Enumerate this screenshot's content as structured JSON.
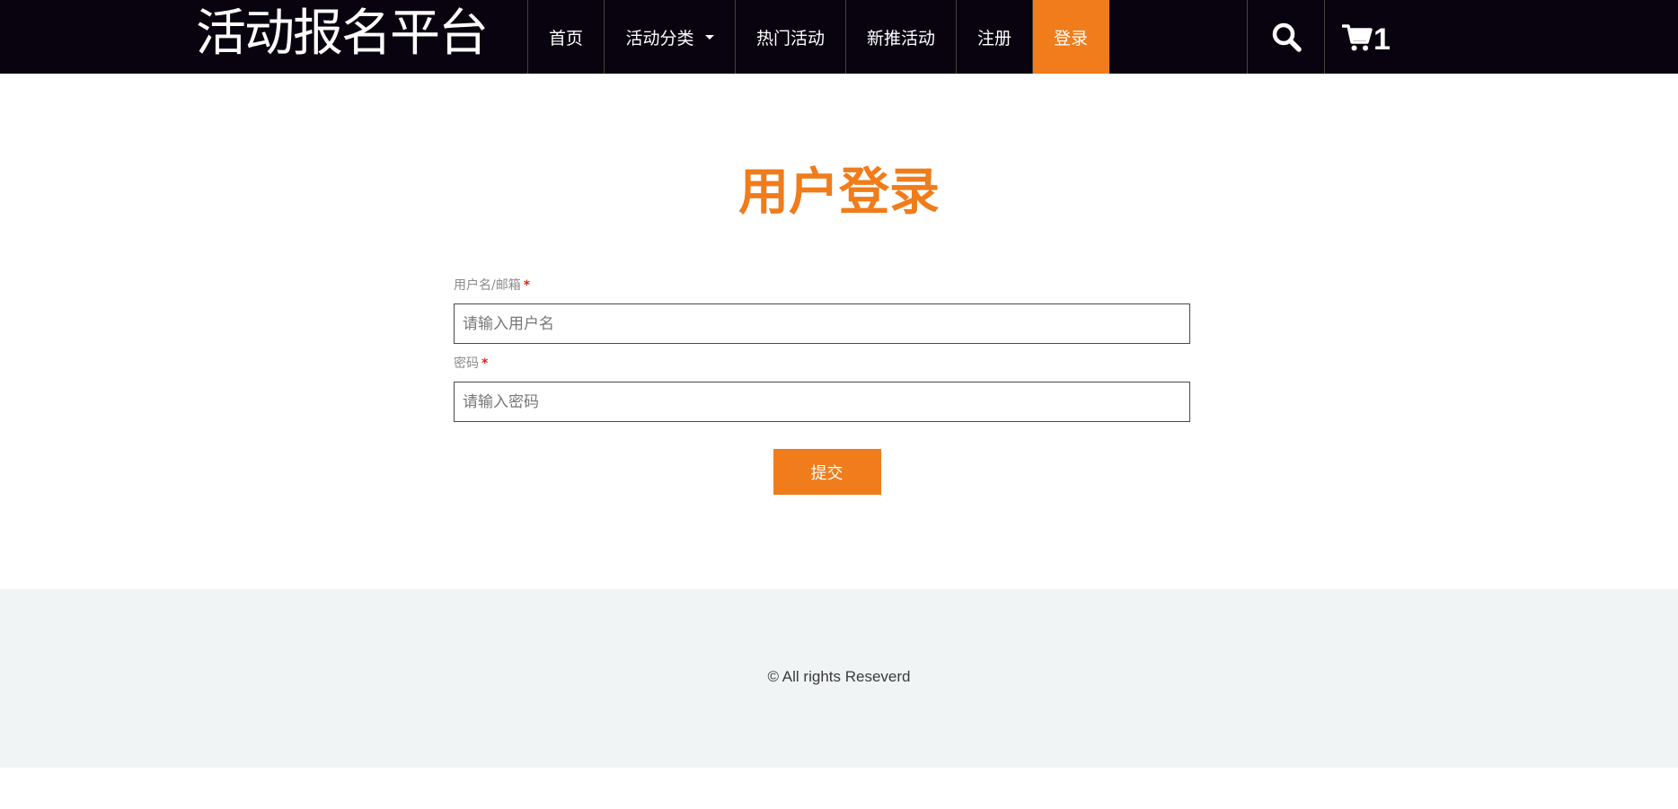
{
  "header": {
    "brand": "活动报名平台",
    "nav": [
      {
        "label": "首页",
        "active": false
      },
      {
        "label": "活动分类",
        "active": false,
        "has_dropdown": true
      },
      {
        "label": "热门活动",
        "active": false
      },
      {
        "label": "新推活动",
        "active": false
      },
      {
        "label": "注册",
        "active": false
      },
      {
        "label": "登录",
        "active": true
      }
    ],
    "search_icon": "search-icon",
    "cart_icon": "cart-icon",
    "cart_count": "1"
  },
  "main": {
    "title": "用户登录",
    "fields": [
      {
        "label": "用户名/邮箱",
        "required_mark": "*",
        "placeholder": "请输入用户名",
        "value": ""
      },
      {
        "label": "密码",
        "required_mark": "*",
        "placeholder": "请输入密码",
        "value": ""
      }
    ],
    "submit_label": "提交"
  },
  "footer": {
    "copyright": "© All rights Reseverd"
  },
  "colors": {
    "header_bg": "#09030f",
    "accent": "#f07c1b",
    "required": "#e2231a",
    "footer_bg": "#f1f4f5"
  }
}
